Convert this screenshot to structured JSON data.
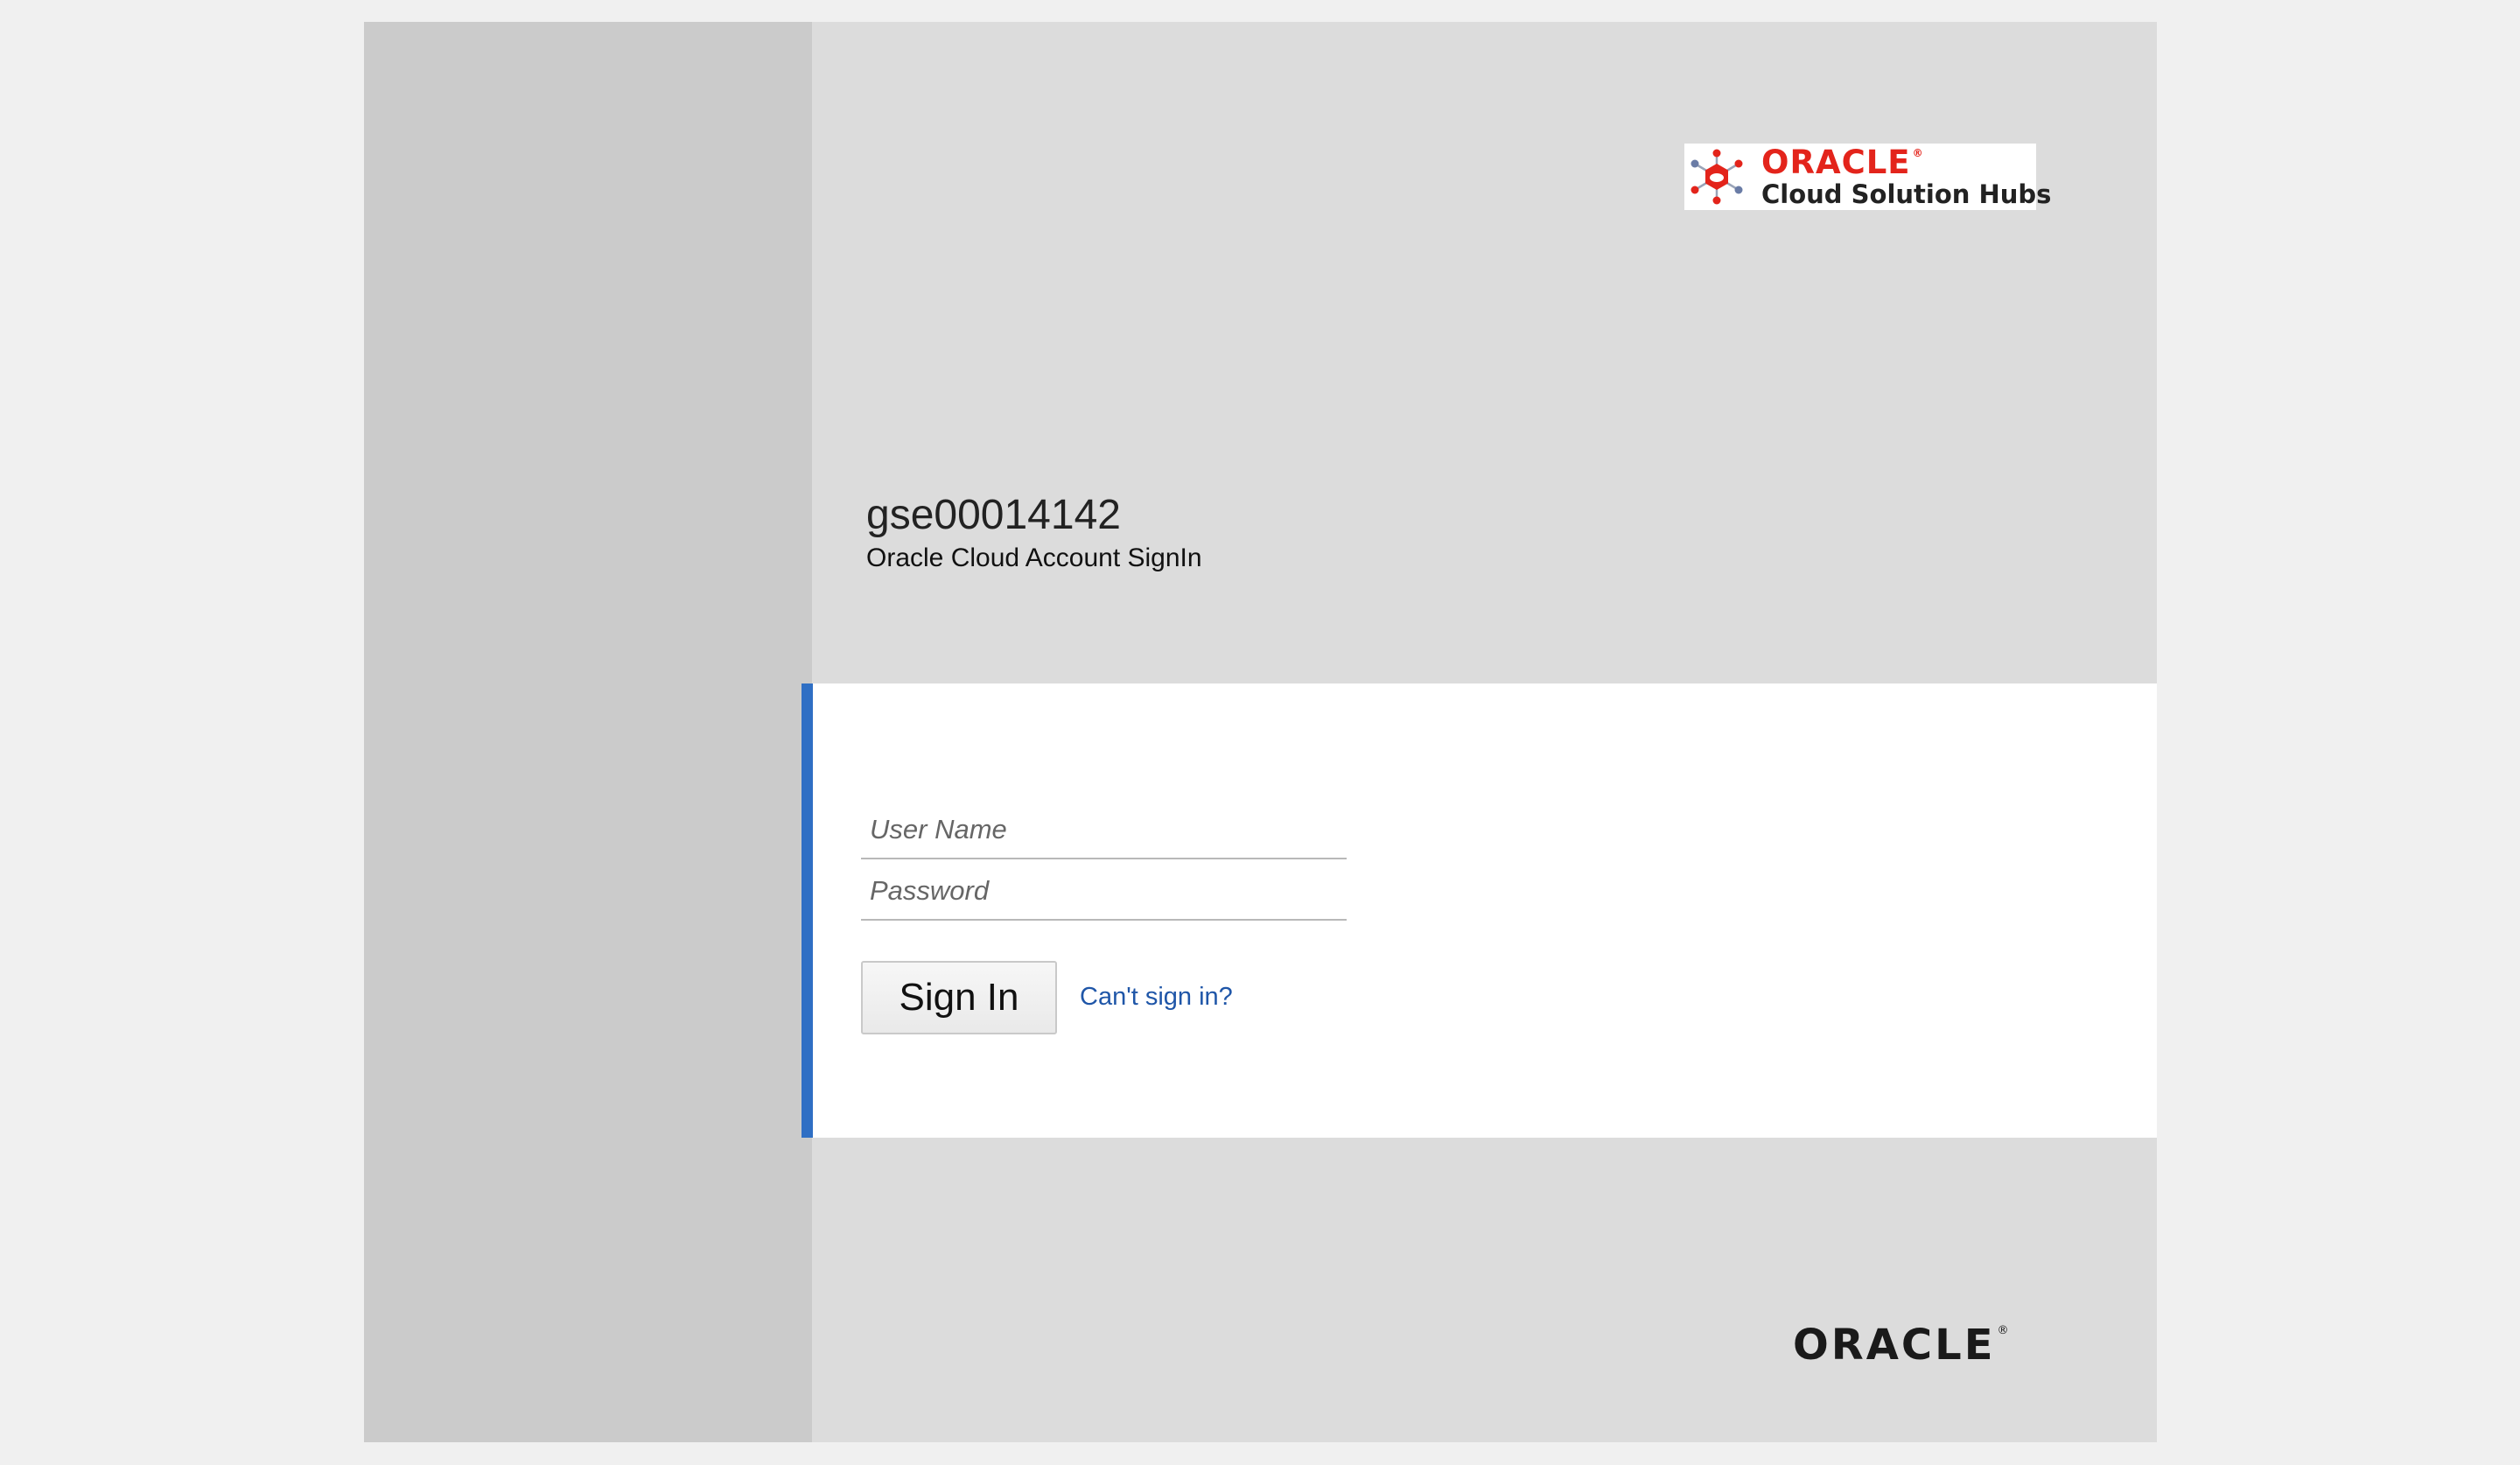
{
  "branding": {
    "logo_word": "ORACLE",
    "logo_registered": "®",
    "logo_subtitle": "Cloud Solution Hubs",
    "hub_icon": "cloud-solution-hubs-icon",
    "accent_red": "#e3241b"
  },
  "header": {
    "identity_domain": "gse00014142",
    "subtitle": "Oracle Cloud Account SignIn"
  },
  "form": {
    "username_placeholder": "User Name",
    "username_value": "",
    "password_placeholder": "Password",
    "password_value": "",
    "signin_label": "Sign In",
    "cant_signin_label": "Can't sign in?",
    "accent_bar_color": "#2f6fc4",
    "link_color": "#1f56a8"
  },
  "footer": {
    "logo_word": "ORACLE",
    "logo_registered": "®"
  }
}
